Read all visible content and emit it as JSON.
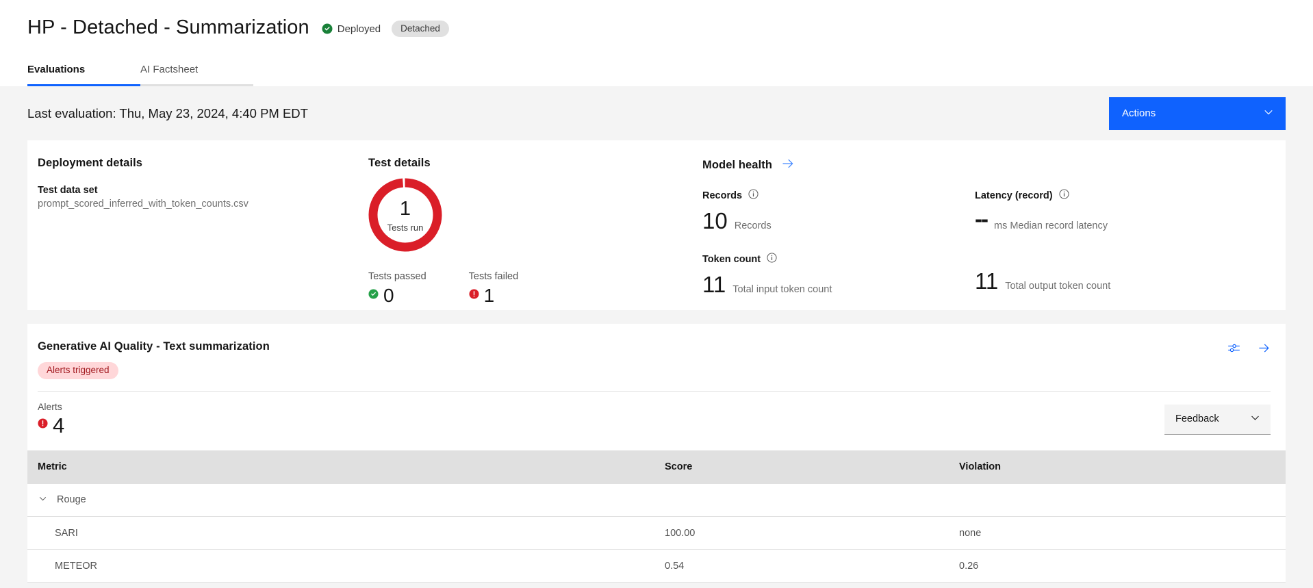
{
  "header": {
    "title": "HP - Detached - Summarization",
    "status_label": "Deployed",
    "status_icon": "check-circle-filled-icon",
    "tag": "Detached",
    "tabs": [
      {
        "label": "Evaluations",
        "active": true
      },
      {
        "label": "AI Factsheet",
        "active": false
      }
    ]
  },
  "subheader": {
    "last_evaluation": "Last evaluation: Thu, May 23, 2024, 4:40 PM EDT",
    "actions_label": "Actions",
    "actions_icon": "chevron-down-icon"
  },
  "deployment_details": {
    "title": "Deployment details",
    "test_data_set_label": "Test data set",
    "test_data_set_value": "prompt_scored_inferred_with_token_counts.csv"
  },
  "test_details": {
    "title": "Test details",
    "donut_value": "1",
    "donut_caption": "Tests run",
    "passed_label": "Tests passed",
    "passed_value": "0",
    "passed_icon": "check-circle-filled-icon",
    "failed_label": "Tests failed",
    "failed_value": "1",
    "failed_icon": "error-filled-icon"
  },
  "model_health": {
    "title": "Model health",
    "link_icon": "arrow-right-icon",
    "metrics": [
      {
        "label": "Records",
        "info_icon": "information-icon",
        "value": "10",
        "unit": "Records"
      },
      {
        "label": "Latency (record)",
        "info_icon": "information-icon",
        "value": "--",
        "unit": "ms Median record latency"
      },
      {
        "label": "Token count",
        "info_icon": "information-icon",
        "value": "11",
        "unit": "Total input token count"
      },
      {
        "label": "",
        "value": "11",
        "unit": "Total output token count"
      }
    ]
  },
  "quality": {
    "title": "Generative AI Quality - Text summarization",
    "alerts_badge": "Alerts triggered",
    "settings_icon": "sliders-icon",
    "open_icon": "arrow-right-icon",
    "alerts_label": "Alerts",
    "alerts_count": "4",
    "alerts_icon": "error-filled-icon",
    "feedback_label": "Feedback",
    "feedback_icon": "chevron-down-icon"
  },
  "table": {
    "columns": [
      "Metric",
      "Score",
      "Violation"
    ],
    "groups": [
      {
        "name": "Rouge",
        "expanded": true,
        "expand_icon": "chevron-down-icon",
        "rows": [
          {
            "metric": "SARI",
            "score": "100.00",
            "violation": "none"
          },
          {
            "metric": "METEOR",
            "score": "0.54",
            "violation": "0.26"
          }
        ]
      }
    ]
  },
  "chart_data": {
    "type": "pie",
    "title": "Test details",
    "categories": [
      "Tests failed",
      "Tests passed"
    ],
    "values": [
      1,
      0
    ],
    "colors": [
      "#da1e28",
      "#24a148"
    ],
    "center_label": "1",
    "center_sublabel": "Tests run",
    "legend": "bottom"
  },
  "colors": {
    "accent_blue": "#0f62fe",
    "danger_red": "#da1e28",
    "success_green": "#24a148",
    "badge_red_bg": "#ffd7d9",
    "badge_red_text": "#a2191f",
    "page_bg": "#f4f4f4"
  }
}
